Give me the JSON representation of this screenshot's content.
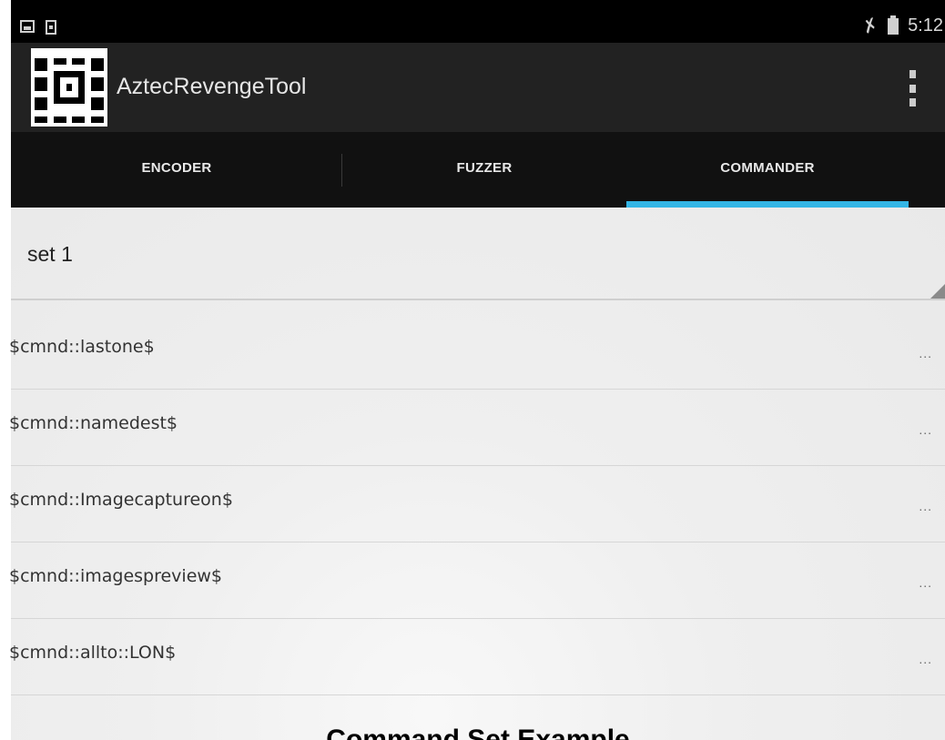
{
  "status_bar": {
    "time": "5:12",
    "icons": [
      "image-notification-icon",
      "phone-notification-icon",
      "mute-icon",
      "battery-icon"
    ]
  },
  "action_bar": {
    "title": "AztecRevengeTool",
    "logo_icon": "aztec-code-icon",
    "menu_icon": "overflow-menu-icon"
  },
  "tabs": [
    {
      "label": "ENCODER",
      "selected": false
    },
    {
      "label": "FUZZER",
      "selected": false
    },
    {
      "label": "COMMANDER",
      "selected": true
    }
  ],
  "spinner": {
    "selected": "set 1"
  },
  "commands": [
    {
      "text": "$cmnd::lastone$",
      "more": "..."
    },
    {
      "text": "$cmnd::namedest$",
      "more": "..."
    },
    {
      "text": "$cmnd::Imagecaptureon$",
      "more": "..."
    },
    {
      "text": "$cmnd::imagespreview$",
      "more": "..."
    },
    {
      "text": "$cmnd::allto::LON$",
      "more": "..."
    }
  ],
  "caption": "Command Set Example",
  "colors": {
    "accent": "#33b5e5",
    "action_bar": "#222222",
    "tab_bar": "#111111",
    "status_bar": "#000000"
  }
}
